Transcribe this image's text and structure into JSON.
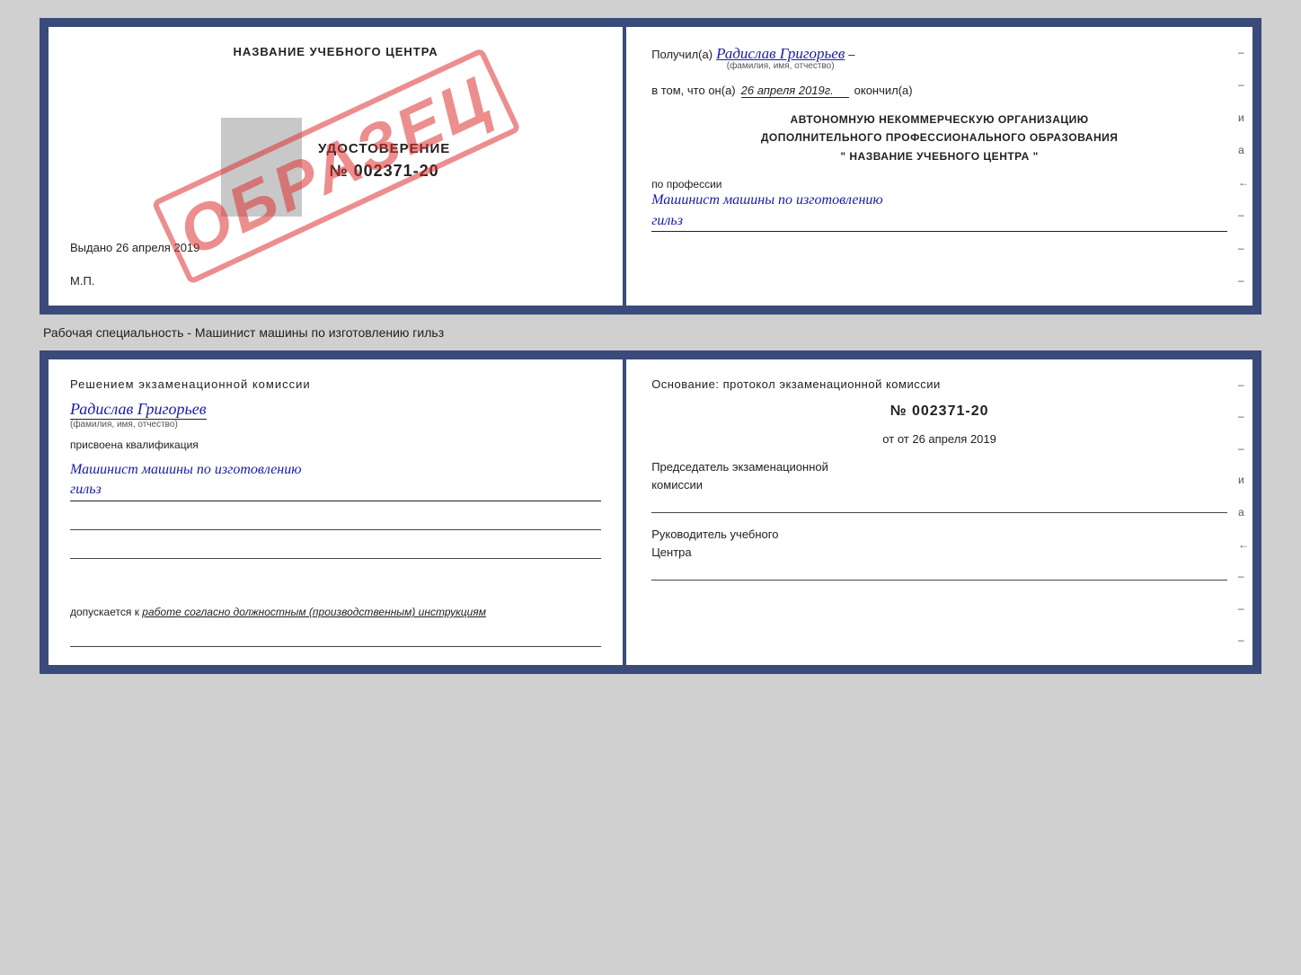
{
  "topDoc": {
    "left": {
      "schoolName": "НАЗВАНИЕ УЧЕБНОГО ЦЕНТРА",
      "stampText": "ОБРАЗЕЦ",
      "udostoverenie": {
        "label": "УДОСТОВЕРЕНИЕ",
        "number": "№ 002371-20"
      },
      "vydano": "Выдано 26 апреля 2019",
      "mp": "М.П."
    },
    "right": {
      "poluchilLabel": "Получил(а)",
      "recipientName": "Радислав Григорьев",
      "familioNote": "(фамилия, имя, отчество)",
      "dash": "–",
      "vtomLabel": "в том, что он(а)",
      "vtomDate": "26 апреля 2019г.",
      "okonchilLabel": "окончил(а)",
      "orgLine1": "АВТОНОМНУЮ НЕКОММЕРЧЕСКУЮ ОРГАНИЗАЦИЮ",
      "orgLine2": "ДОПОЛНИТЕЛЬНОГО ПРОФЕССИОНАЛЬНОГО ОБРАЗОВАНИЯ",
      "orgLine3": "\"    НАЗВАНИЕ УЧЕБНОГО ЦЕНТРА    \"",
      "poProfessiiLabel": "по профессии",
      "professiyaLine1": "Машинист машины по изготовлению",
      "professiyaLine2": "гильз",
      "dashes": [
        "–",
        "–",
        "и",
        "а",
        "←",
        "–",
        "–",
        "–"
      ]
    }
  },
  "separator": {
    "text": "Рабочая специальность - Машинист машины по изготовлению гильз"
  },
  "bottomDoc": {
    "left": {
      "resheniyLabel": "Решением  экзаменационной  комиссии",
      "recipientName": "Радислав Григорьев",
      "familioNote": "(фамилия, имя, отчество)",
      "prisvoenaLabel": "присвоена квалификация",
      "kvalLine1": "Машинист машины по изготовлению",
      "kvalLine2": "гильз",
      "dopuskaetsyaLabel": "допускается к",
      "dopuskaetsyaItalic": "работе согласно должностным (производственным) инструкциям"
    },
    "right": {
      "osnovanieLabelFull": "Основание:  протокол  экзаменационной  комиссии",
      "protocolNumber": "№  002371-20",
      "otDate": "от 26 апреля 2019",
      "predsedatelLabel": "Председатель экзаменационной\nкомиссии",
      "rukovoditelLabel": "Руководитель учебного\nЦентра",
      "dashes": [
        "–",
        "–",
        "–",
        "и",
        "а",
        "←",
        "–",
        "–",
        "–"
      ]
    }
  }
}
